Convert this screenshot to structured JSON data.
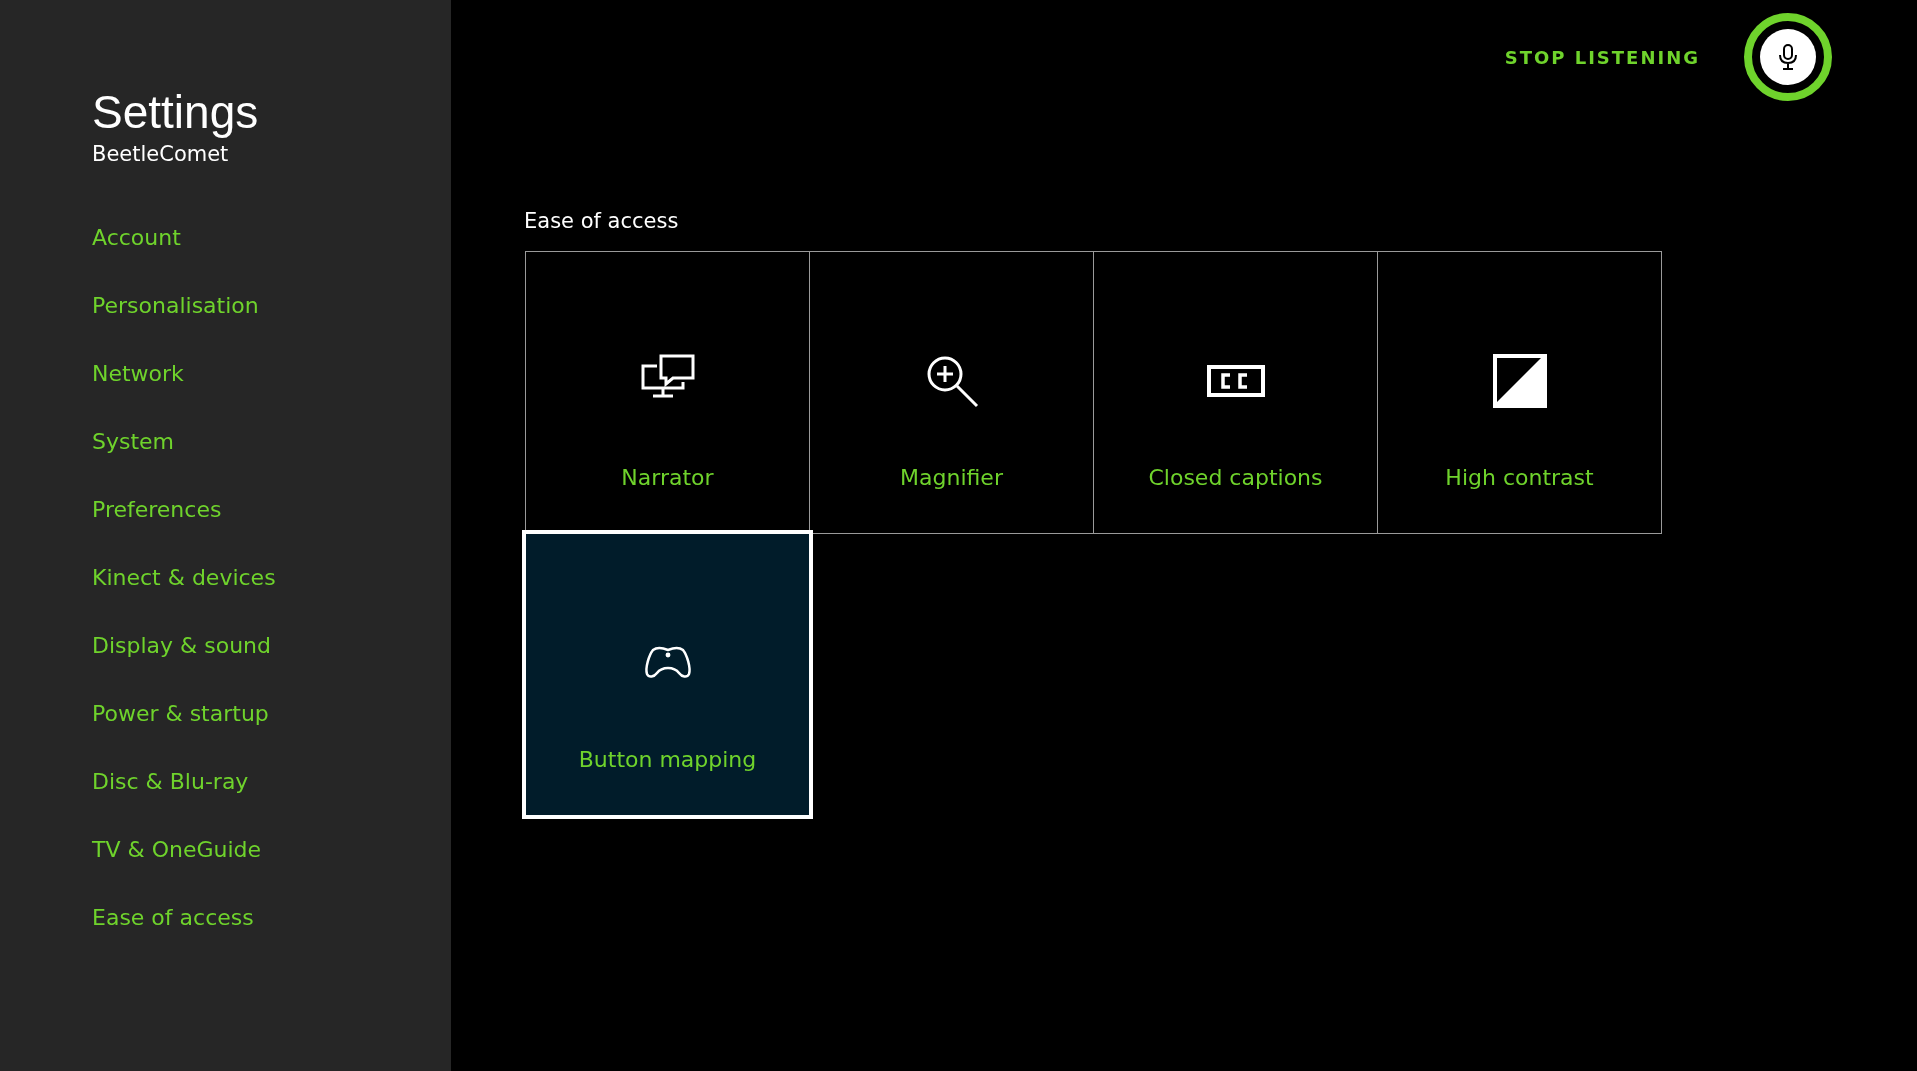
{
  "sidebar": {
    "title": "Settings",
    "user": "BeetleComet",
    "items": [
      "Account",
      "Personalisation",
      "Network",
      "System",
      "Preferences",
      "Kinect & devices",
      "Display & sound",
      "Power & startup",
      "Disc & Blu-ray",
      "TV & OneGuide",
      "Ease of access"
    ]
  },
  "voice": {
    "label": "STOP LISTENING",
    "listening": true
  },
  "section": {
    "title": "Ease of access",
    "tiles": [
      {
        "kind": "narrator",
        "label": "Narrator",
        "selected": false
      },
      {
        "kind": "magnifier",
        "label": "Magnifier",
        "selected": false
      },
      {
        "kind": "captions",
        "label": "Closed captions",
        "selected": false
      },
      {
        "kind": "contrast",
        "label": "High contrast",
        "selected": false
      },
      {
        "kind": "controller",
        "label": "Button mapping",
        "selected": true
      }
    ]
  }
}
